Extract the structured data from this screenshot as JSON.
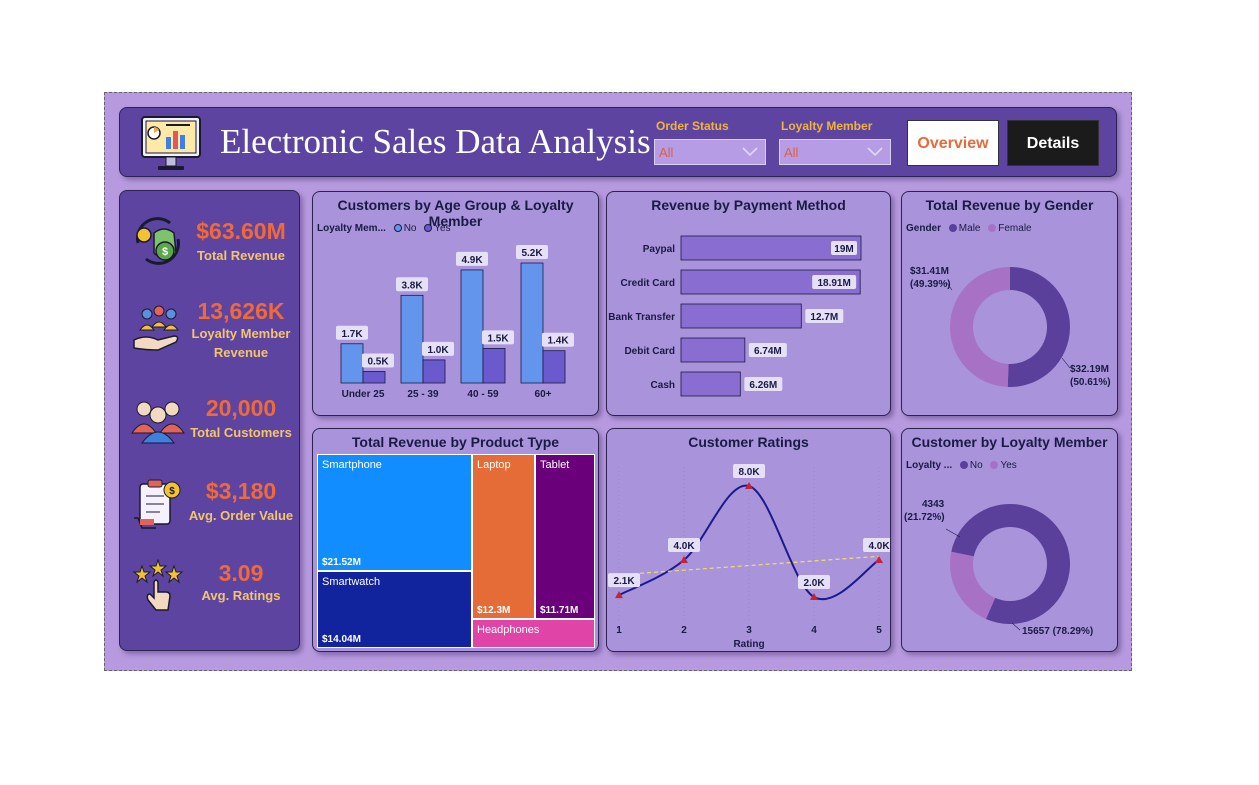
{
  "header": {
    "title": "Electronic Sales Data Analysis",
    "filters": [
      {
        "label": "Order Status",
        "value": "All"
      },
      {
        "label": "Loyalty Member",
        "value": "All"
      }
    ],
    "nav": [
      {
        "label": "Overview"
      },
      {
        "label": "Details"
      }
    ]
  },
  "kpis": [
    {
      "value": "$63.60M",
      "label": "Total Revenue",
      "icon": "money-bag-icon"
    },
    {
      "value": "13,626K",
      "label": "Loyalty Member Revenue",
      "icon": "loyalty-hand-icon"
    },
    {
      "value": "20,000",
      "label": "Total Customers",
      "icon": "customers-icon"
    },
    {
      "value": "$3,180",
      "label": "Avg. Order Value",
      "icon": "order-clipboard-icon"
    },
    {
      "value": "3.09",
      "label": "Avg. Ratings",
      "icon": "rating-stars-icon"
    }
  ],
  "colors": {
    "accent": "#ef6a3a",
    "bar_no": "#6495ed",
    "bar_yes": "#6a5acd",
    "male": "#5a3f9b",
    "female": "#a771c5"
  },
  "chart_data": [
    {
      "id": "age",
      "type": "bar",
      "title": "Customers by Age Group & Loyalty Member",
      "legend_title": "Loyalty Mem...",
      "categories": [
        "Under 25",
        "25 - 39",
        "40 - 59",
        "60+"
      ],
      "series": [
        {
          "name": "No",
          "values": [
            1.7,
            3.8,
            4.9,
            5.2
          ],
          "labels": [
            "1.7K",
            "3.8K",
            "4.9K",
            "5.2K"
          ]
        },
        {
          "name": "Yes",
          "values": [
            0.5,
            1.0,
            1.5,
            1.4
          ],
          "labels": [
            "0.5K",
            "1.0K",
            "1.5K",
            "1.4K"
          ]
        }
      ]
    },
    {
      "id": "payment",
      "type": "bar",
      "orientation": "horizontal",
      "title": "Revenue by Payment Method",
      "categories": [
        "Paypal",
        "Credit Card",
        "Bank Transfer",
        "Debit Card",
        "Cash"
      ],
      "values": [
        19.0,
        18.91,
        12.7,
        6.74,
        6.26
      ],
      "labels": [
        "19M",
        "18.91M",
        "12.7M",
        "6.74M",
        "6.26M"
      ]
    },
    {
      "id": "gender",
      "type": "pie",
      "title": "Total Revenue by Gender",
      "legend_title": "Gender",
      "slices": [
        {
          "name": "Male",
          "value": 32.19,
          "label": "$32.19M",
          "pct": "(50.61%)"
        },
        {
          "name": "Female",
          "value": 31.41,
          "label": "$31.41M",
          "pct": "(49.39%)"
        }
      ]
    },
    {
      "id": "product",
      "type": "heatmap",
      "title": "Total Revenue by Product Type",
      "items": [
        {
          "name": "Smartphone",
          "value": 21.52,
          "label": "$21.52M",
          "color": "#118dff"
        },
        {
          "name": "Smartwatch",
          "value": 14.04,
          "label": "$14.04M",
          "color": "#12239e"
        },
        {
          "name": "Laptop",
          "value": 12.3,
          "label": "$12.3M",
          "color": "#e66c37"
        },
        {
          "name": "Tablet",
          "value": 11.71,
          "label": "$11.71M",
          "color": "#6b007b"
        },
        {
          "name": "Headphones",
          "value": null,
          "label": "",
          "color": "#e044a7"
        }
      ]
    },
    {
      "id": "ratings",
      "type": "line",
      "title": "Customer Ratings",
      "xlabel": "Rating",
      "x": [
        1,
        2,
        3,
        4,
        5
      ],
      "y": [
        2.1,
        4.0,
        8.0,
        2.0,
        4.0
      ],
      "labels": [
        "2.1K",
        "4.0K",
        "8.0K",
        "2.0K",
        "4.0K"
      ],
      "trend": "dashed"
    },
    {
      "id": "loyalty",
      "type": "pie",
      "title": "Customer by Loyalty Member",
      "legend_title": "Loyalty ...",
      "slices": [
        {
          "name": "No",
          "value": 15657,
          "label": "15657 (78.29%)"
        },
        {
          "name": "Yes",
          "value": 4343,
          "label": "4343",
          "pct": "(21.72%)"
        }
      ]
    }
  ]
}
